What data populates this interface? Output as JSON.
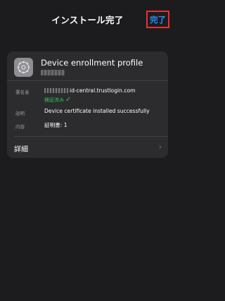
{
  "nav": {
    "title": "インストール完了",
    "done_label": "完了"
  },
  "profile": {
    "name": "Device enrollment profile",
    "icon": "settings-gear-icon",
    "fields": {
      "signer_label": "署名者",
      "signer_value": "id-central.trustlogin.com",
      "verified_text": "検証済み",
      "description_label": "説明",
      "description_value": "Device certificate installed successfully",
      "contents_label": "内容",
      "contents_value": "証明書: 1"
    },
    "details_label": "詳細"
  },
  "colors": {
    "background": "#1c1c1e",
    "card": "#2c2c2e",
    "accent": "#2f8cff",
    "verified": "#34c759",
    "highlight_border": "#e8312f"
  }
}
